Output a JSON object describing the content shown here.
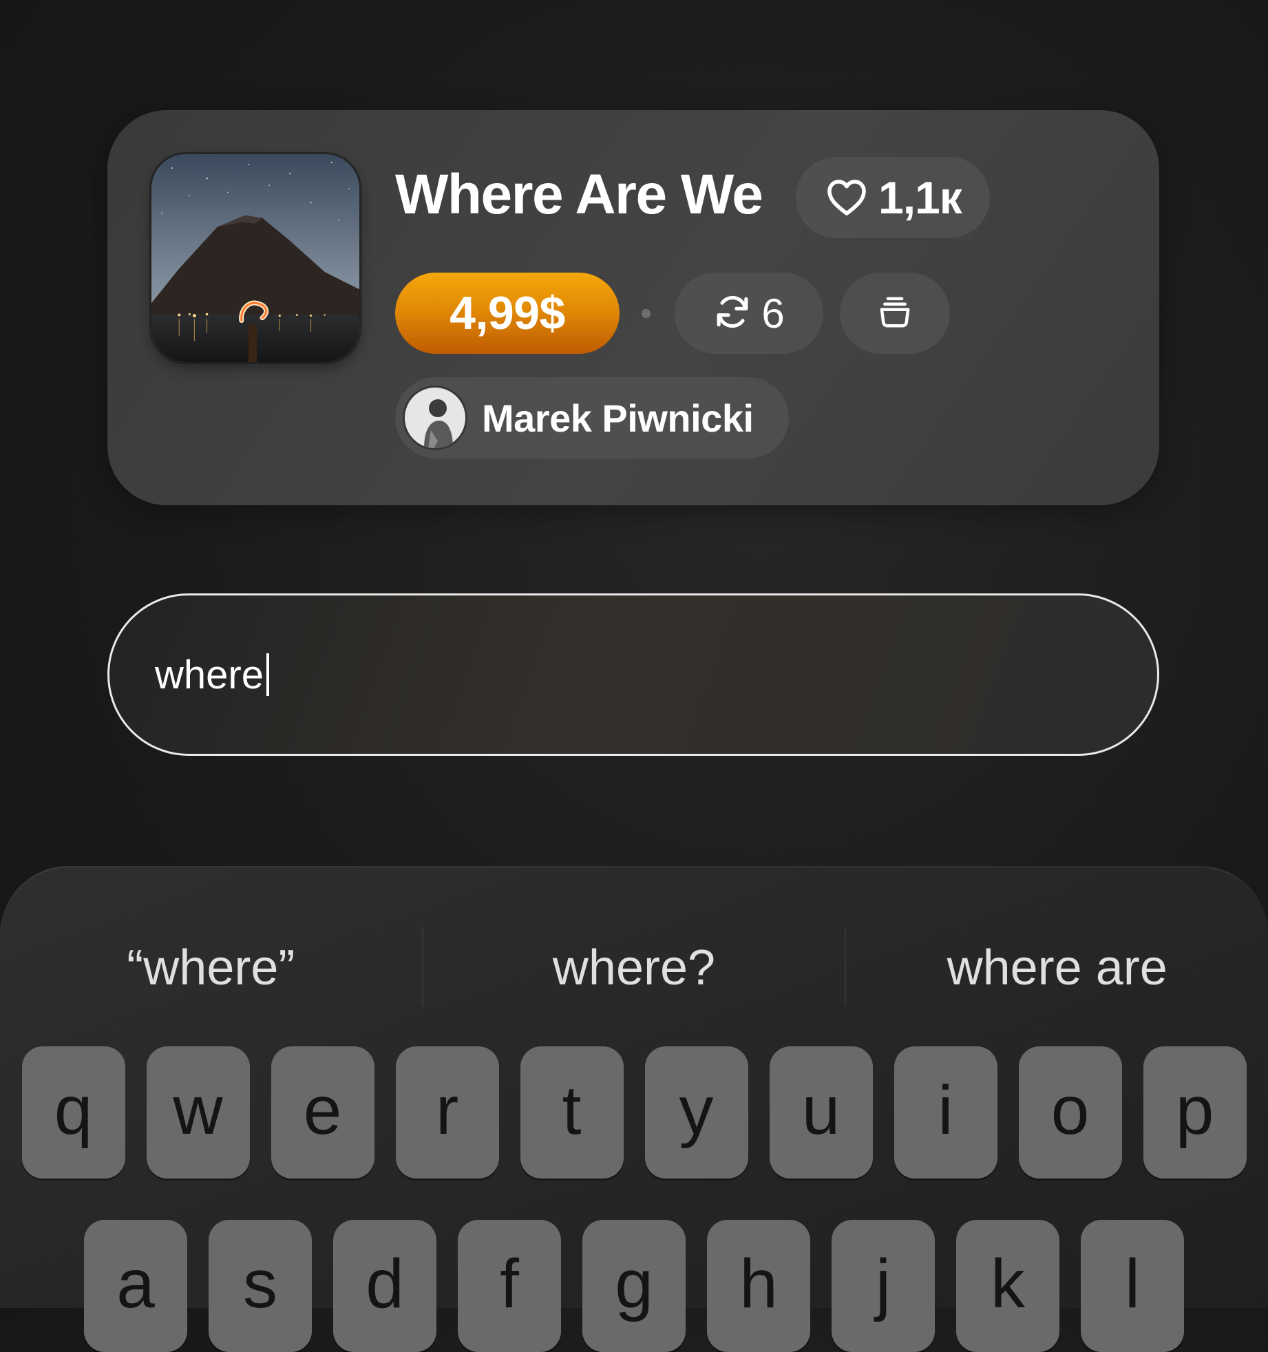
{
  "card": {
    "cover_alt": "mountain night sky with lake lights",
    "title": "Where Are We",
    "likes": "1,1к",
    "likes_icon": "heart-icon",
    "price": "4,99$",
    "reposts": "6",
    "reposts_icon": "repeat-icon",
    "save_icon": "stack-icon",
    "author": "Marek Piwnicki"
  },
  "search": {
    "value": "where"
  },
  "keyboard": {
    "suggestions": [
      "“where”",
      "where?",
      "where are"
    ],
    "row1": [
      "q",
      "w",
      "e",
      "r",
      "t",
      "y",
      "u",
      "i",
      "o",
      "p"
    ],
    "row2": [
      "a",
      "s",
      "d",
      "f",
      "g",
      "h",
      "j",
      "k",
      "l"
    ]
  },
  "colors": {
    "accent_top": "#f5a70a",
    "accent_bottom": "#bf5c02",
    "key_bg": "#6a6a6a"
  }
}
